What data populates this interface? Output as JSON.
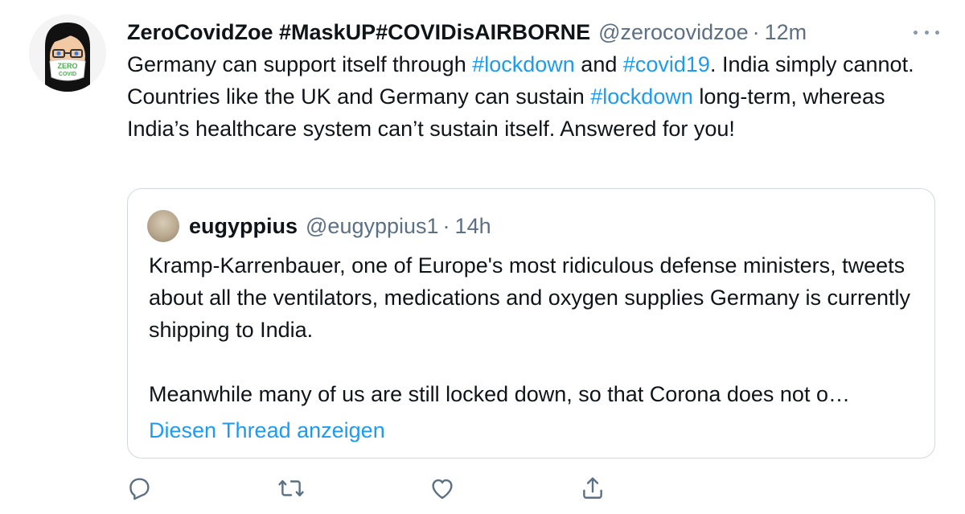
{
  "tweet": {
    "display_name": "ZeroCovidZoe #MaskUP#COVIDisAIRBORNE",
    "handle": "@zerocovidzoe",
    "separator": "·",
    "time": "12m",
    "avatar_text_line1": "ZERO",
    "avatar_text_line2": "COVID",
    "text_parts": [
      "Germany can support itself through ",
      "#lockdown",
      " and ",
      "#covid19",
      ". India simply cannot. Countries like the UK and Germany can sustain ",
      "#lockdown",
      " long-term, whereas India’s healthcare system can’t sustain itself. Answered for you!"
    ]
  },
  "quote": {
    "display_name": "eugyppius",
    "handle": "@eugyppius1",
    "separator": "·",
    "time": "14h",
    "paragraph1": "Kramp-Karrenbauer, one of Europe's most ridiculous defense ministers, tweets about all the ventilators, medications and oxygen supplies Germany is currently shipping to India.",
    "paragraph2": "Meanwhile many of us are still locked down, so that Corona does not o…",
    "show_thread": "Diesen Thread anzeigen"
  },
  "icons": {
    "more": "more-horizontal-icon",
    "reply": "reply-icon",
    "retweet": "retweet-icon",
    "like": "heart-icon",
    "share": "share-icon"
  },
  "colors": {
    "link": "#1d9bf0",
    "secondary_text": "#5b7083",
    "border": "#cfd9de",
    "icon": "#5b7083"
  }
}
